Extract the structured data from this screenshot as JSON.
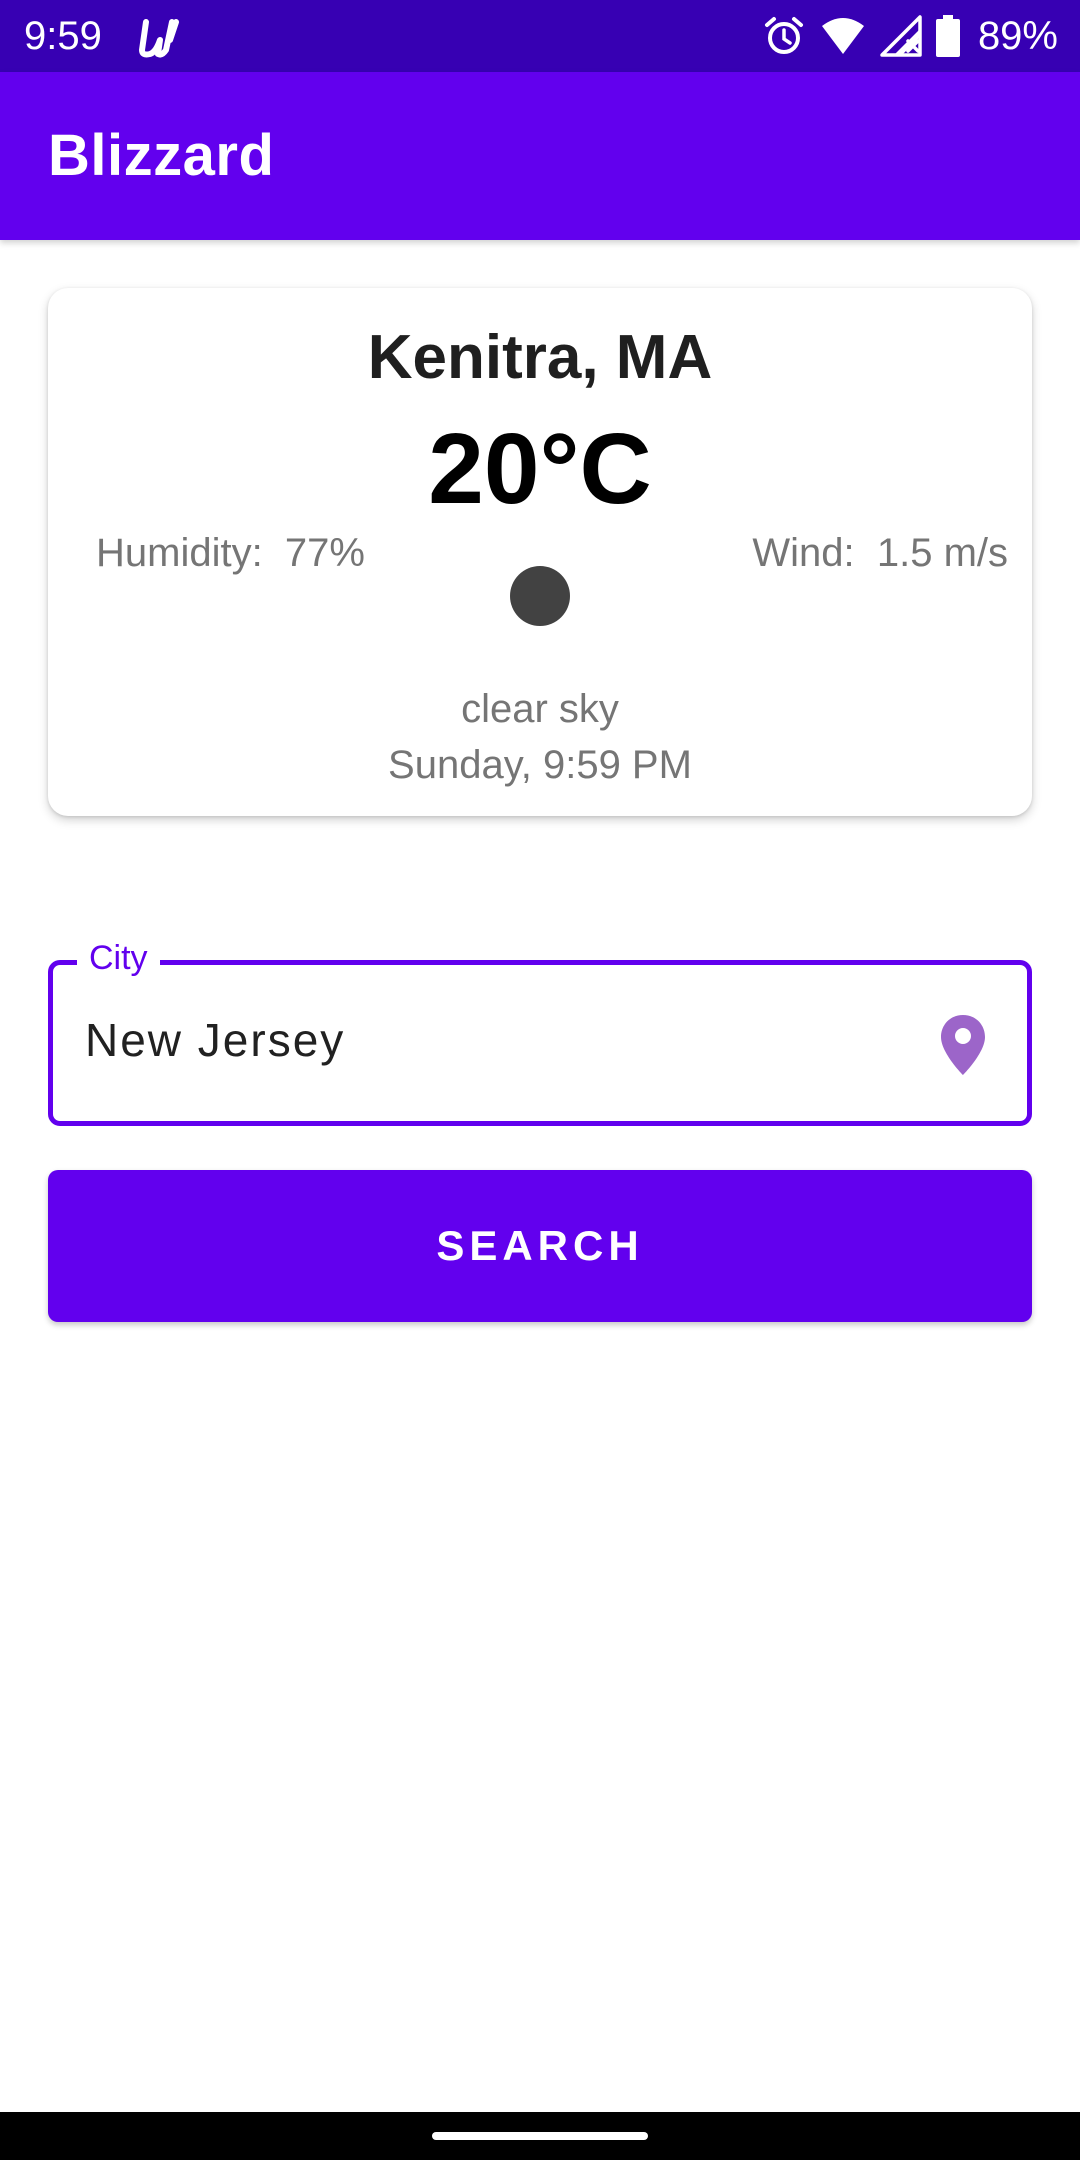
{
  "status_bar": {
    "time": "9:59",
    "battery": "89%",
    "icons": [
      "app-u-icon",
      "alarm-icon",
      "wifi-icon",
      "signal-icon",
      "battery-icon"
    ]
  },
  "app_bar": {
    "title": "Blizzard"
  },
  "weather": {
    "city": "Kenitra, MA",
    "temperature": "20°C",
    "humidity": "Humidity:  77%",
    "wind": "Wind:  1.5 m/s",
    "icon": "weather-icon",
    "description": "clear sky",
    "datetime": "Sunday, 9:59 PM"
  },
  "search": {
    "field_label": "City",
    "value": "New Jersey",
    "field_icon": "location-pin-icon",
    "button_label": "SEARCH"
  },
  "colors": {
    "status_bar": "#3700b3",
    "primary": "#6200ee",
    "location_icon": "#9c65c9",
    "secondary_text": "#757575",
    "weather_icon": "#424242"
  }
}
